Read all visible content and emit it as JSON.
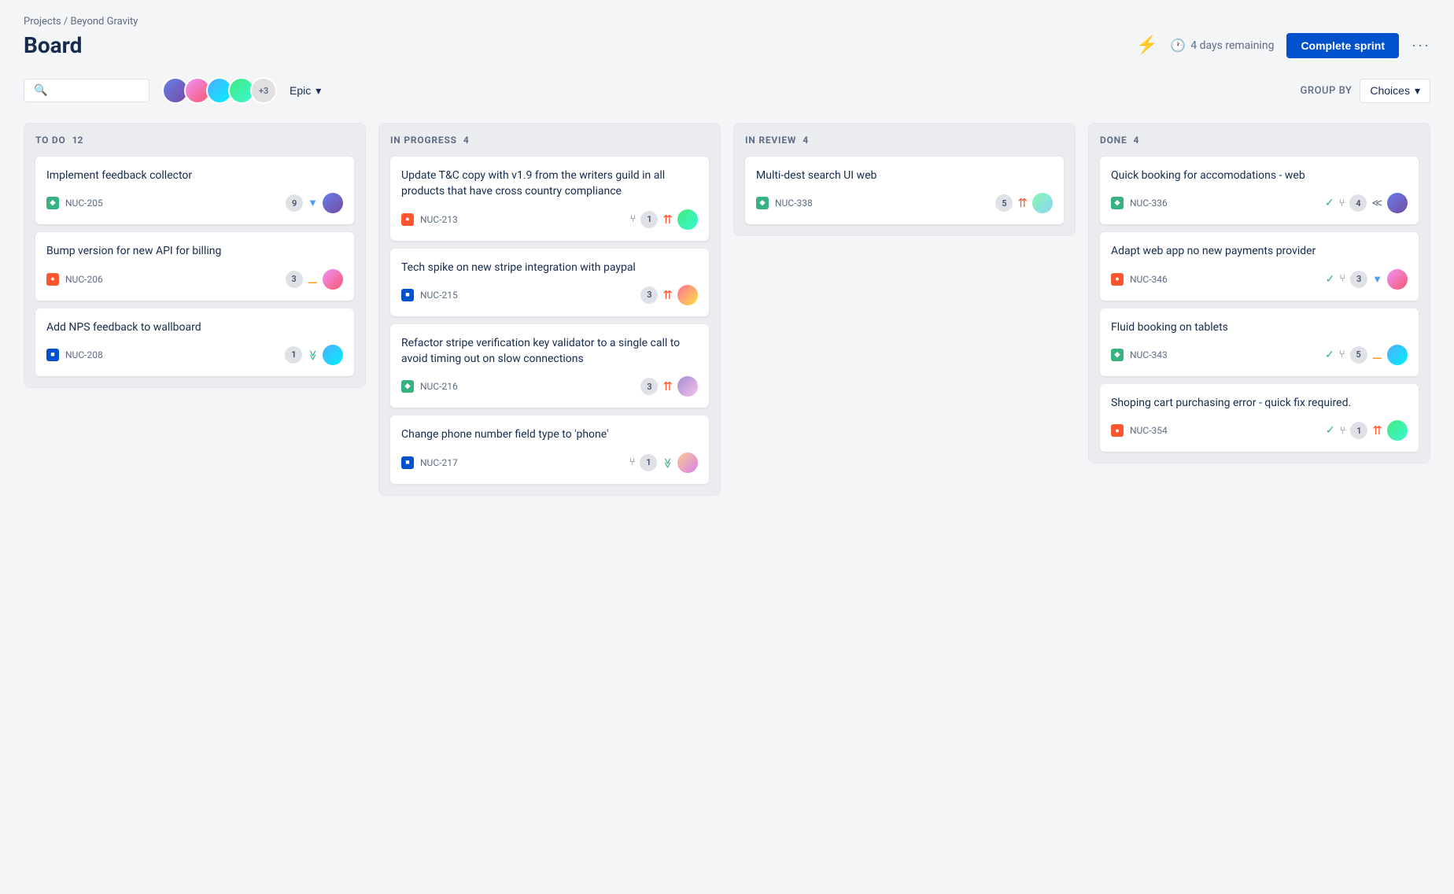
{
  "breadcrumb": "Projects / Beyond Gravity",
  "pageTitle": "Board",
  "header": {
    "daysRemaining": "4 days remaining",
    "completeSprintLabel": "Complete sprint"
  },
  "toolbar": {
    "searchPlaceholder": "",
    "epicLabel": "Epic",
    "groupByLabel": "GROUP BY",
    "choicesLabel": "Choices",
    "avatarCount": "+3"
  },
  "columns": [
    {
      "id": "todo",
      "title": "TO DO",
      "count": 12,
      "cards": [
        {
          "title": "Implement feedback collector",
          "issueType": "story",
          "issueId": "NUC-205",
          "count": 9,
          "priority": "low",
          "prioritySymbol": "▼",
          "avatarClass": "av1"
        },
        {
          "title": "Bump version for new API for billing",
          "issueType": "bug",
          "issueId": "NUC-206",
          "count": 3,
          "priority": "medium",
          "prioritySymbol": "═",
          "avatarClass": "av2"
        },
        {
          "title": "Add NPS feedback to wallboard",
          "issueType": "task",
          "issueId": "NUC-208",
          "count": 1,
          "priority": "low",
          "prioritySymbol": "≫",
          "avatarClass": "av3"
        }
      ]
    },
    {
      "id": "inprogress",
      "title": "IN PROGRESS",
      "count": 4,
      "cards": [
        {
          "title": "Update T&C copy with v1.9 from the writers guild in all products that have cross country compliance",
          "issueType": "bug",
          "issueId": "NUC-213",
          "count": 1,
          "priority": "critical",
          "prioritySymbol": "⇈",
          "branchCount": 1,
          "avatarClass": "av4"
        },
        {
          "title": "Tech spike on new stripe integration with paypal",
          "issueType": "task",
          "issueId": "NUC-215",
          "count": 3,
          "priority": "high",
          "prioritySymbol": "⇈",
          "avatarClass": "av5"
        },
        {
          "title": "Refactor stripe verification key validator to a single call to avoid timing out on slow connections",
          "issueType": "story",
          "issueId": "NUC-216",
          "count": 3,
          "priority": "high",
          "prioritySymbol": "⇈",
          "avatarClass": "av6"
        },
        {
          "title": "Change phone number field type to 'phone'",
          "issueType": "task",
          "issueId": "NUC-217",
          "count": 1,
          "priority": "low",
          "prioritySymbol": "≫",
          "branchCount": 1,
          "avatarClass": "av7"
        }
      ]
    },
    {
      "id": "inreview",
      "title": "IN REVIEW",
      "count": 4,
      "cards": [
        {
          "title": "Multi-dest search UI web",
          "issueType": "story",
          "issueId": "NUC-338",
          "count": 5,
          "priority": "high",
          "prioritySymbol": "∧",
          "avatarClass": "av8"
        }
      ]
    },
    {
      "id": "done",
      "title": "DONE",
      "count": 4,
      "cards": [
        {
          "title": "Quick booking for accomodations - web",
          "issueType": "story",
          "issueId": "NUC-336",
          "count": 4,
          "priority": "low",
          "prioritySymbol": "≪",
          "hasCheck": true,
          "branchCount": null,
          "avatarClass": "av1"
        },
        {
          "title": "Adapt web app no new payments provider",
          "issueType": "bug",
          "issueId": "NUC-346",
          "count": 3,
          "priority": "low",
          "prioritySymbol": "▼",
          "hasCheck": true,
          "avatarClass": "av2"
        },
        {
          "title": "Fluid booking on tablets",
          "issueType": "story",
          "issueId": "NUC-343",
          "count": 5,
          "priority": "medium",
          "prioritySymbol": "═",
          "hasCheck": true,
          "avatarClass": "av3"
        },
        {
          "title": "Shoping cart purchasing error - quick fix required.",
          "issueType": "bug",
          "issueId": "NUC-354",
          "count": 1,
          "priority": "critical",
          "prioritySymbol": "⇈",
          "hasCheck": true,
          "avatarClass": "av4"
        }
      ]
    }
  ]
}
